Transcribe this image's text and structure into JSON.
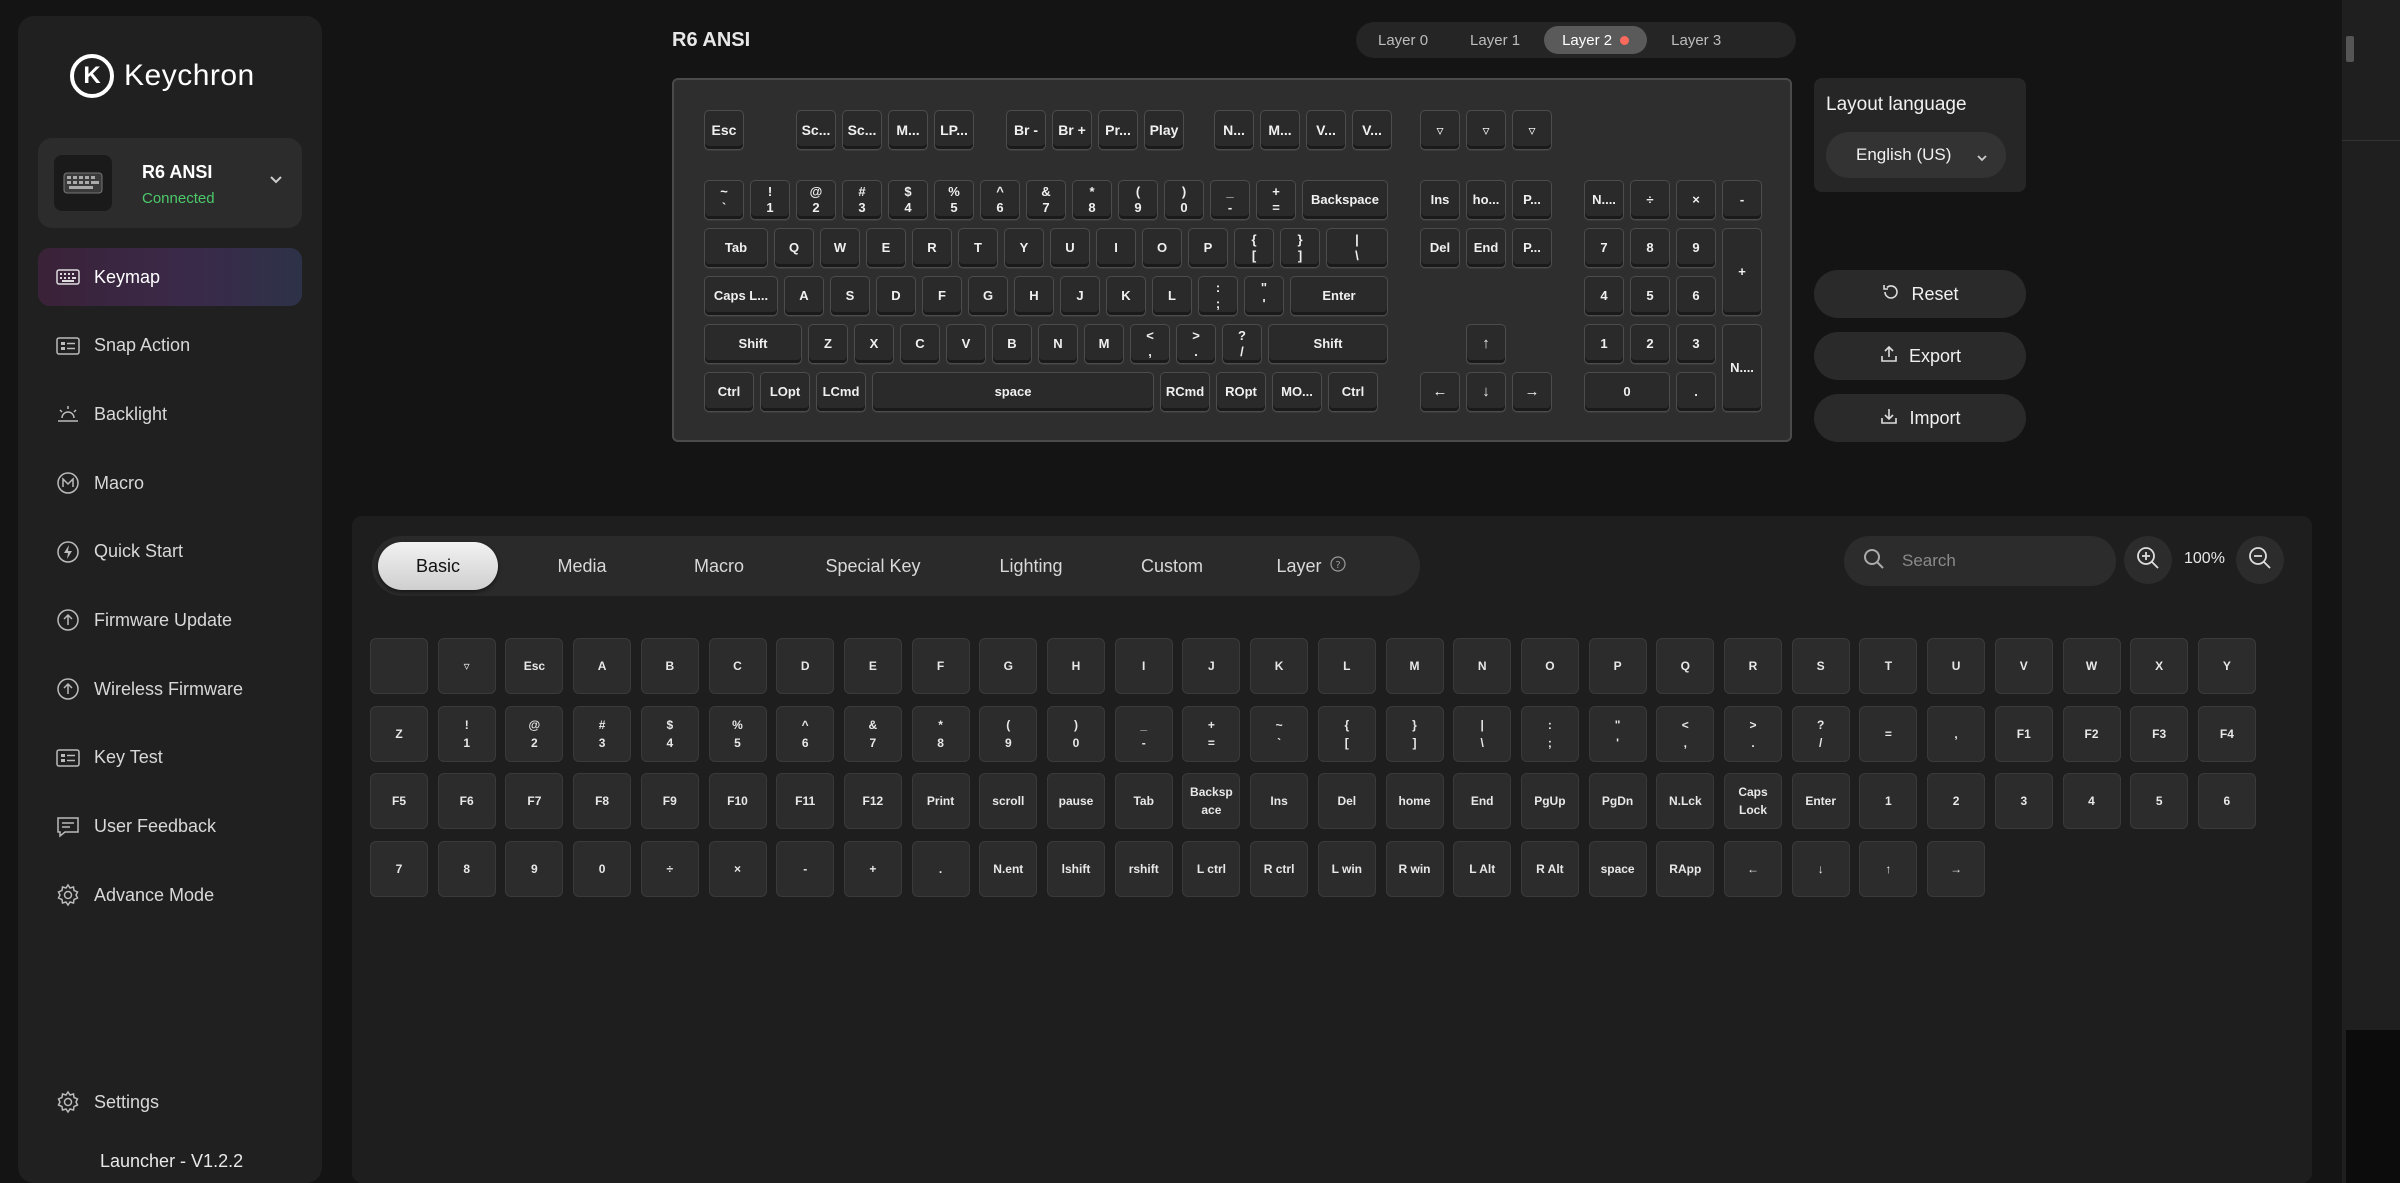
{
  "app": {
    "brand": "Keychron",
    "version": "Launcher - V1.2.2"
  },
  "device": {
    "name": "R6 ANSI",
    "status": "Connected"
  },
  "nav": [
    {
      "label": "Keymap",
      "icon": "keyboard-icon",
      "active": true
    },
    {
      "label": "Snap Action",
      "icon": "snap-action-icon"
    },
    {
      "label": "Backlight",
      "icon": "backlight-icon"
    },
    {
      "label": "Macro",
      "icon": "macro-icon"
    },
    {
      "label": "Quick Start",
      "icon": "lightning-icon"
    },
    {
      "label": "Firmware Update",
      "icon": "upload-circle-icon"
    },
    {
      "label": "Wireless Firmware",
      "icon": "upload-circle-icon"
    },
    {
      "label": "Key Test",
      "icon": "key-test-icon"
    },
    {
      "label": "User Feedback",
      "icon": "feedback-icon"
    },
    {
      "label": "Advance Mode",
      "icon": "gear-icon"
    }
  ],
  "settings_label": "Settings",
  "keyboard_title": "R6 ANSI",
  "layers": [
    "Layer 0",
    "Layer 1",
    "Layer 2",
    "Layer 3"
  ],
  "active_layer": "Layer 2",
  "keys": {
    "fn": [
      "Esc",
      "Sc...",
      "Sc...",
      "M...",
      "LP...",
      "Br -",
      "Br +",
      "Pr...",
      "Play",
      "N...",
      "M...",
      "V...",
      "V..."
    ],
    "fn_extra": [
      "▿",
      "▿",
      "▿"
    ],
    "num": [
      "~\n`",
      "!\n1",
      "@\n2",
      "#\n3",
      "$\n4",
      "%\n5",
      "^\n6",
      "&\n7",
      "*\n8",
      "(\n9",
      ")\n0",
      "_\n-",
      "+\n=",
      "Backspace"
    ],
    "tab": [
      "Tab",
      "Q",
      "W",
      "E",
      "R",
      "T",
      "Y",
      "U",
      "I",
      "O",
      "P",
      "{\n[",
      "}\n]",
      "|\n\\"
    ],
    "caps": [
      "Caps L...",
      "A",
      "S",
      "D",
      "F",
      "G",
      "H",
      "J",
      "K",
      "L",
      ":\n;",
      "\"\n'",
      "Enter"
    ],
    "shift": [
      "Shift",
      "Z",
      "X",
      "C",
      "V",
      "B",
      "N",
      "M",
      "<\n,",
      ">\n.",
      "?\n/",
      "Shift"
    ],
    "ctrl": [
      "Ctrl",
      "LOpt",
      "LCmd",
      "space",
      "RCmd",
      "ROpt",
      "MO...",
      "Ctrl"
    ],
    "nav1": [
      "Ins",
      "ho...",
      "P..."
    ],
    "nav2": [
      "Del",
      "End",
      "P..."
    ],
    "arrows": [
      "↑",
      "←",
      "↓",
      "→"
    ],
    "numpad": [
      "N....",
      "÷",
      "×",
      "-",
      "7",
      "8",
      "9",
      "+",
      "4",
      "5",
      "6",
      "1",
      "2",
      "3",
      "N....",
      "0",
      "."
    ]
  },
  "layout_language": {
    "title": "Layout language",
    "value": "English (US)"
  },
  "actions": {
    "reset": "Reset",
    "export": "Export",
    "import": "Import"
  },
  "categories": [
    "Basic",
    "Media",
    "Macro",
    "Special Key",
    "Lighting",
    "Custom",
    "Layer"
  ],
  "active_category": "Basic",
  "search": {
    "placeholder": "Search"
  },
  "zoom": "100%",
  "palette_rows": [
    [
      "",
      "▿",
      "Esc",
      "A",
      "B",
      "C",
      "D",
      "E",
      "F",
      "G",
      "H",
      "I",
      "J",
      "K",
      "L",
      "M",
      "N",
      "O",
      "P",
      "Q",
      "R",
      "S",
      "T",
      "U",
      "V",
      "W",
      "X",
      "Y"
    ],
    [
      "Z",
      "!\n1",
      "@\n2",
      "#\n3",
      "$\n4",
      "%\n5",
      "^\n6",
      "&\n7",
      "*\n8",
      "(\n9",
      ")\n0",
      "_\n-",
      "+\n=",
      "~\n`",
      "{\n[",
      "}\n]",
      "|\n\\",
      ":\n;",
      "\"\n'",
      "<\n,",
      ">\n.",
      "?\n/",
      "=",
      ",",
      "F1",
      "F2",
      "F3",
      "F4"
    ],
    [
      "F5",
      "F6",
      "F7",
      "F8",
      "F9",
      "F10",
      "F11",
      "F12",
      "Print",
      "scroll",
      "pause",
      "Tab",
      "Backsp\nace",
      "Ins",
      "Del",
      "home",
      "End",
      "PgUp",
      "PgDn",
      "N.Lck",
      "Caps\nLock",
      "Enter",
      "1",
      "2",
      "3",
      "4",
      "5",
      "6"
    ],
    [
      "7",
      "8",
      "9",
      "0",
      "÷",
      "×",
      "-",
      "+",
      ".",
      "N.ent",
      "lshift",
      "rshift",
      "L ctrl",
      "R ctrl",
      "L win",
      "R win",
      "L Alt",
      "R Alt",
      "space",
      "RApp",
      "←",
      "↓",
      "↑",
      "→"
    ]
  ]
}
